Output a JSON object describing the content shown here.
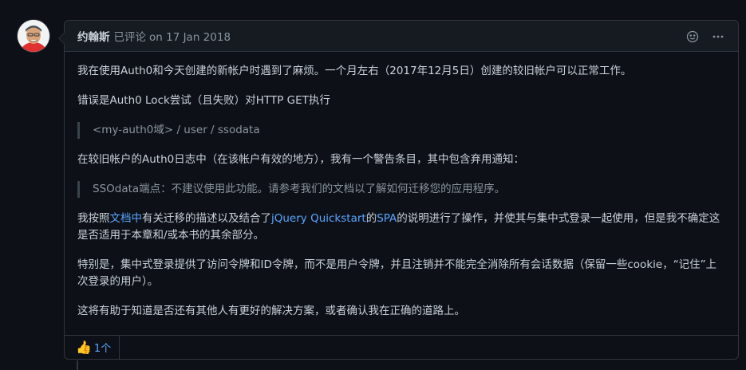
{
  "comment": {
    "author": "约翰斯",
    "action": "已评论",
    "date": "on 17 Jan 2018",
    "icons": {
      "emoji": "smiley-icon",
      "more": "kebab-horizontal-icon"
    },
    "paragraphs": {
      "p1": "我在使用Auth0和今天创建的新帐户时遇到了麻烦。一个月左右（2017年12月5日）创建的较旧帐户可以正常工作。",
      "p2": "错误是Auth0 Lock尝试（且失败）对HTTP GET执行",
      "quote1": "<my-auth0域> / user / ssodata",
      "p3": "在较旧帐户的Auth0日志中（在该帐户有效的地方），我有一个警告条目，其中包含弃用通知：",
      "quote2": "SSOdata端点：不建议使用此功能。请参考我们的文档以了解如何迁移您的应用程序。",
      "p4": {
        "part1": "我按照",
        "link1": "文档中",
        "part2": "有关迁移的描述以及结合了",
        "link2": "jQuery Quickstart",
        "part3": "的",
        "link3": "SPA",
        "part4": "的说明进行了操作，并使其与集中式登录一起使用，但是我不确定这是否适用于本章和/或本书的其余部分。"
      },
      "p5": "特别是，集中式登录提供了访问令牌和ID令牌，而不是用户令牌，并且注销并不能完全消除所有会话数据（保留一些cookie，“记住”上次登录的用户）。",
      "p6": "这将有助于知道是否还有其他人有更好的解决方案，或者确认我在正确的道路上。"
    },
    "reactions": [
      {
        "emoji": "👍",
        "count": "1个"
      }
    ]
  },
  "colors": {
    "background": "#0d1117",
    "header": "#161b22",
    "border": "#30363d",
    "link": "#58a6ff",
    "muted": "#8b949e",
    "text": "#c9d1d9"
  }
}
